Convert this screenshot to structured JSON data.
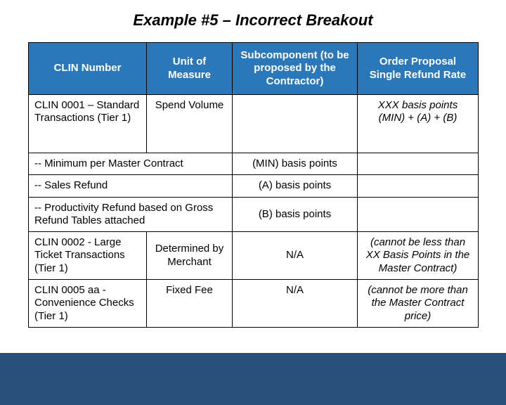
{
  "title": "Example #5 – Incorrect Breakout",
  "headers": {
    "clin": "CLIN Number",
    "uom": "Unit of Measure",
    "subcomponent": "Subcomponent (to be proposed by the Contractor)",
    "order_proposal": "Order Proposal Single Refund Rate"
  },
  "rows": [
    {
      "clin": "CLIN 0001 – Standard Transactions\n(Tier 1)",
      "uom": "Spend Volume",
      "sub": "",
      "proposal": "XXX basis points (MIN) + (A) + (B)"
    },
    {
      "label": "-- Minimum per Master Contract",
      "sub": "(MIN) basis points",
      "proposal": ""
    },
    {
      "label": "-- Sales Refund",
      "sub": "(A) basis points",
      "proposal": ""
    },
    {
      "label": "-- Productivity Refund based on Gross Refund Tables attached",
      "sub": "(B) basis points",
      "proposal": ""
    },
    {
      "clin": "CLIN 0002 - Large Ticket Transactions (Tier 1)",
      "uom": "Determined by Merchant",
      "sub": "N/A",
      "proposal": "(cannot be less than XX Basis Points in the Master Contract)"
    },
    {
      "clin": "CLIN 0005 aa - Convenience Checks (Tier 1)",
      "uom": "Fixed Fee",
      "sub": "N/A",
      "proposal": "(cannot be more than the Master Contract price)"
    }
  ],
  "colors": {
    "header_bg": "#2a77ba",
    "footer_band": "#294e78",
    "border": "#000000"
  }
}
